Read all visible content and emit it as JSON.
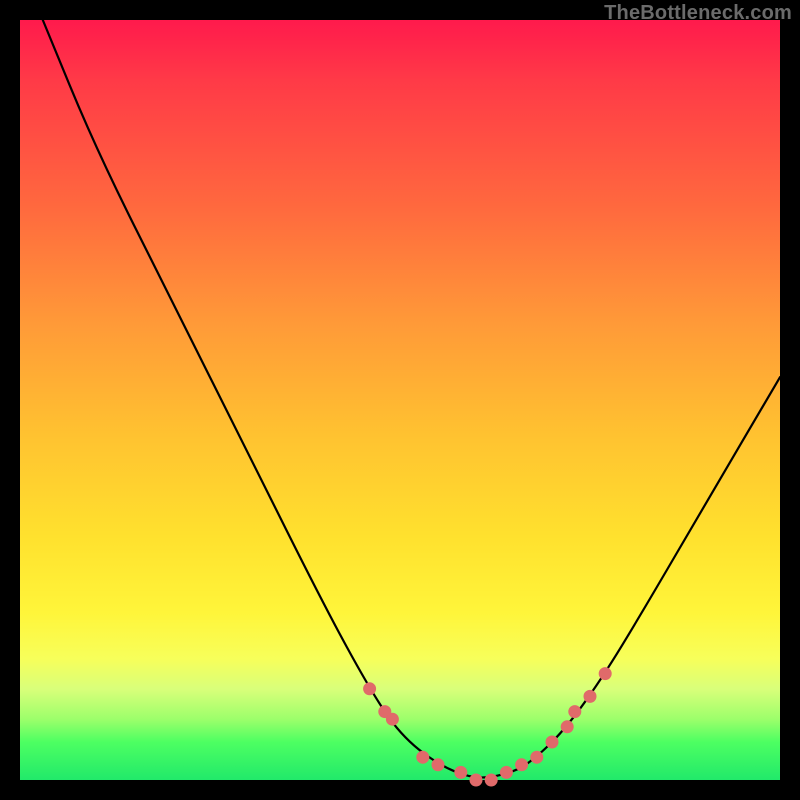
{
  "watermark": "TheBottleneck.com",
  "colors": {
    "frame": "#000000",
    "gradient_top": "#ff1a4c",
    "gradient_mid1": "#ff9a38",
    "gradient_mid2": "#ffe12e",
    "gradient_bottom": "#21e96a",
    "curve": "#000000",
    "dots": "#e06a6a"
  },
  "chart_data": {
    "type": "line",
    "title": "",
    "xlabel": "",
    "ylabel": "",
    "xlim": [
      0,
      100
    ],
    "ylim": [
      0,
      100
    ],
    "grid": false,
    "legend": false,
    "series": [
      {
        "name": "bottleneck-curve",
        "x": [
          3,
          10,
          20,
          30,
          40,
          46,
          50,
          55,
          60,
          65,
          68,
          72,
          77,
          83,
          90,
          100
        ],
        "y": [
          100,
          83,
          63,
          43,
          23,
          12,
          6,
          2,
          0,
          1,
          3,
          7,
          14,
          24,
          36,
          53
        ]
      }
    ],
    "marked_points": {
      "name": "highlighted-dots",
      "x": [
        46,
        48,
        49,
        53,
        55,
        58,
        60,
        62,
        64,
        66,
        68,
        70,
        72,
        73,
        75,
        77
      ],
      "y": [
        12,
        9,
        8,
        3,
        2,
        1,
        0,
        0,
        1,
        2,
        3,
        5,
        7,
        9,
        11,
        14
      ]
    }
  }
}
